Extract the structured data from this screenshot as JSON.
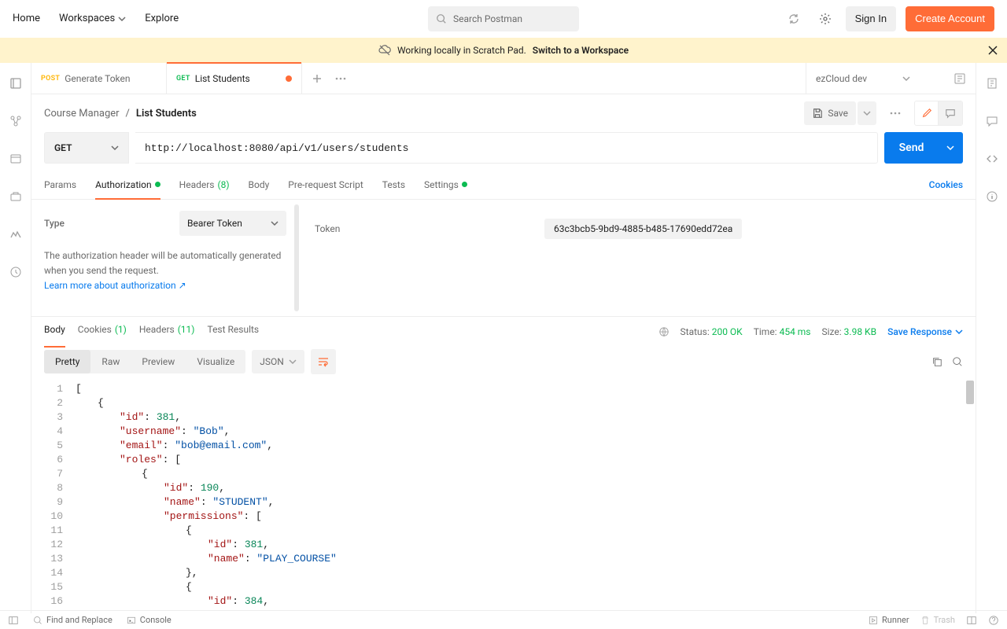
{
  "header": {
    "nav": {
      "home": "Home",
      "workspaces": "Workspaces",
      "explore": "Explore"
    },
    "search_placeholder": "Search Postman",
    "sign_in": "Sign In",
    "create_account": "Create Account"
  },
  "scratchpad": {
    "msg": "Working locally in Scratch Pad.",
    "link": "Switch to a Workspace"
  },
  "tabs": [
    {
      "method": "POST",
      "label": "Generate Token"
    },
    {
      "method": "GET",
      "label": "List Students",
      "dirty": true
    }
  ],
  "env": {
    "name": "ezCloud dev"
  },
  "breadcrumb": {
    "parent": "Course Manager",
    "current": "List Students"
  },
  "save_label": "Save",
  "request": {
    "method": "GET",
    "url": "http://localhost:8080/api/v1/users/students",
    "send": "Send",
    "subtabs": {
      "params": "Params",
      "authorization": "Authorization",
      "headers": "Headers",
      "headers_count": "(8)",
      "body": "Body",
      "prerequest": "Pre-request Script",
      "tests": "Tests",
      "settings": "Settings"
    },
    "cookies_link": "Cookies"
  },
  "auth": {
    "type_label": "Type",
    "type_value": "Bearer Token",
    "help_1": "The authorization header will be automatically generated when you send the request.",
    "help_link": "Learn more about authorization ↗",
    "token_label": "Token",
    "token_value": "63c3bcb5-9bd9-4885-b485-17690edd72ea"
  },
  "response": {
    "tabs": {
      "body": "Body",
      "cookies": "Cookies",
      "cookies_count": "(1)",
      "headers": "Headers",
      "headers_count": "(11)",
      "tests": "Test Results"
    },
    "status_label": "Status:",
    "status_value": "200 OK",
    "time_label": "Time:",
    "time_value": "454 ms",
    "size_label": "Size:",
    "size_value": "3.98 KB",
    "save_response": "Save Response",
    "view": {
      "pretty": "Pretty",
      "raw": "Raw",
      "preview": "Preview",
      "visualize": "Visualize"
    },
    "format": "JSON",
    "code_lines": [
      {
        "n": 1,
        "i": 0,
        "t": [
          [
            "bracket",
            "["
          ]
        ]
      },
      {
        "n": 2,
        "i": 1,
        "t": [
          [
            "bracket",
            "{"
          ]
        ]
      },
      {
        "n": 3,
        "i": 2,
        "t": [
          [
            "key",
            "\"id\""
          ],
          [
            "colon",
            ": "
          ],
          [
            "num",
            "381"
          ],
          [
            "bracket",
            ","
          ]
        ]
      },
      {
        "n": 4,
        "i": 2,
        "t": [
          [
            "key",
            "\"username\""
          ],
          [
            "colon",
            ": "
          ],
          [
            "str",
            "\"Bob\""
          ],
          [
            "bracket",
            ","
          ]
        ]
      },
      {
        "n": 5,
        "i": 2,
        "t": [
          [
            "key",
            "\"email\""
          ],
          [
            "colon",
            ": "
          ],
          [
            "str",
            "\"bob@email.com\""
          ],
          [
            "bracket",
            ","
          ]
        ]
      },
      {
        "n": 6,
        "i": 2,
        "t": [
          [
            "key",
            "\"roles\""
          ],
          [
            "colon",
            ": "
          ],
          [
            "bracket",
            "["
          ]
        ]
      },
      {
        "n": 7,
        "i": 3,
        "t": [
          [
            "bracket",
            "{"
          ]
        ]
      },
      {
        "n": 8,
        "i": 4,
        "t": [
          [
            "key",
            "\"id\""
          ],
          [
            "colon",
            ": "
          ],
          [
            "num",
            "190"
          ],
          [
            "bracket",
            ","
          ]
        ]
      },
      {
        "n": 9,
        "i": 4,
        "t": [
          [
            "key",
            "\"name\""
          ],
          [
            "colon",
            ": "
          ],
          [
            "str",
            "\"STUDENT\""
          ],
          [
            "bracket",
            ","
          ]
        ]
      },
      {
        "n": 10,
        "i": 4,
        "t": [
          [
            "key",
            "\"permissions\""
          ],
          [
            "colon",
            ": "
          ],
          [
            "bracket",
            "["
          ]
        ]
      },
      {
        "n": 11,
        "i": 5,
        "t": [
          [
            "bracket",
            "{"
          ]
        ]
      },
      {
        "n": 12,
        "i": 6,
        "t": [
          [
            "key",
            "\"id\""
          ],
          [
            "colon",
            ": "
          ],
          [
            "num",
            "381"
          ],
          [
            "bracket",
            ","
          ]
        ]
      },
      {
        "n": 13,
        "i": 6,
        "t": [
          [
            "key",
            "\"name\""
          ],
          [
            "colon",
            ": "
          ],
          [
            "str",
            "\"PLAY_COURSE\""
          ]
        ]
      },
      {
        "n": 14,
        "i": 5,
        "t": [
          [
            "bracket",
            "},"
          ]
        ]
      },
      {
        "n": 15,
        "i": 5,
        "t": [
          [
            "bracket",
            "{"
          ]
        ]
      },
      {
        "n": 16,
        "i": 6,
        "t": [
          [
            "key",
            "\"id\""
          ],
          [
            "colon",
            ": "
          ],
          [
            "num",
            "384"
          ],
          [
            "bracket",
            ","
          ]
        ]
      }
    ]
  },
  "footer": {
    "find": "Find and Replace",
    "console": "Console",
    "runner": "Runner",
    "trash": "Trash"
  }
}
